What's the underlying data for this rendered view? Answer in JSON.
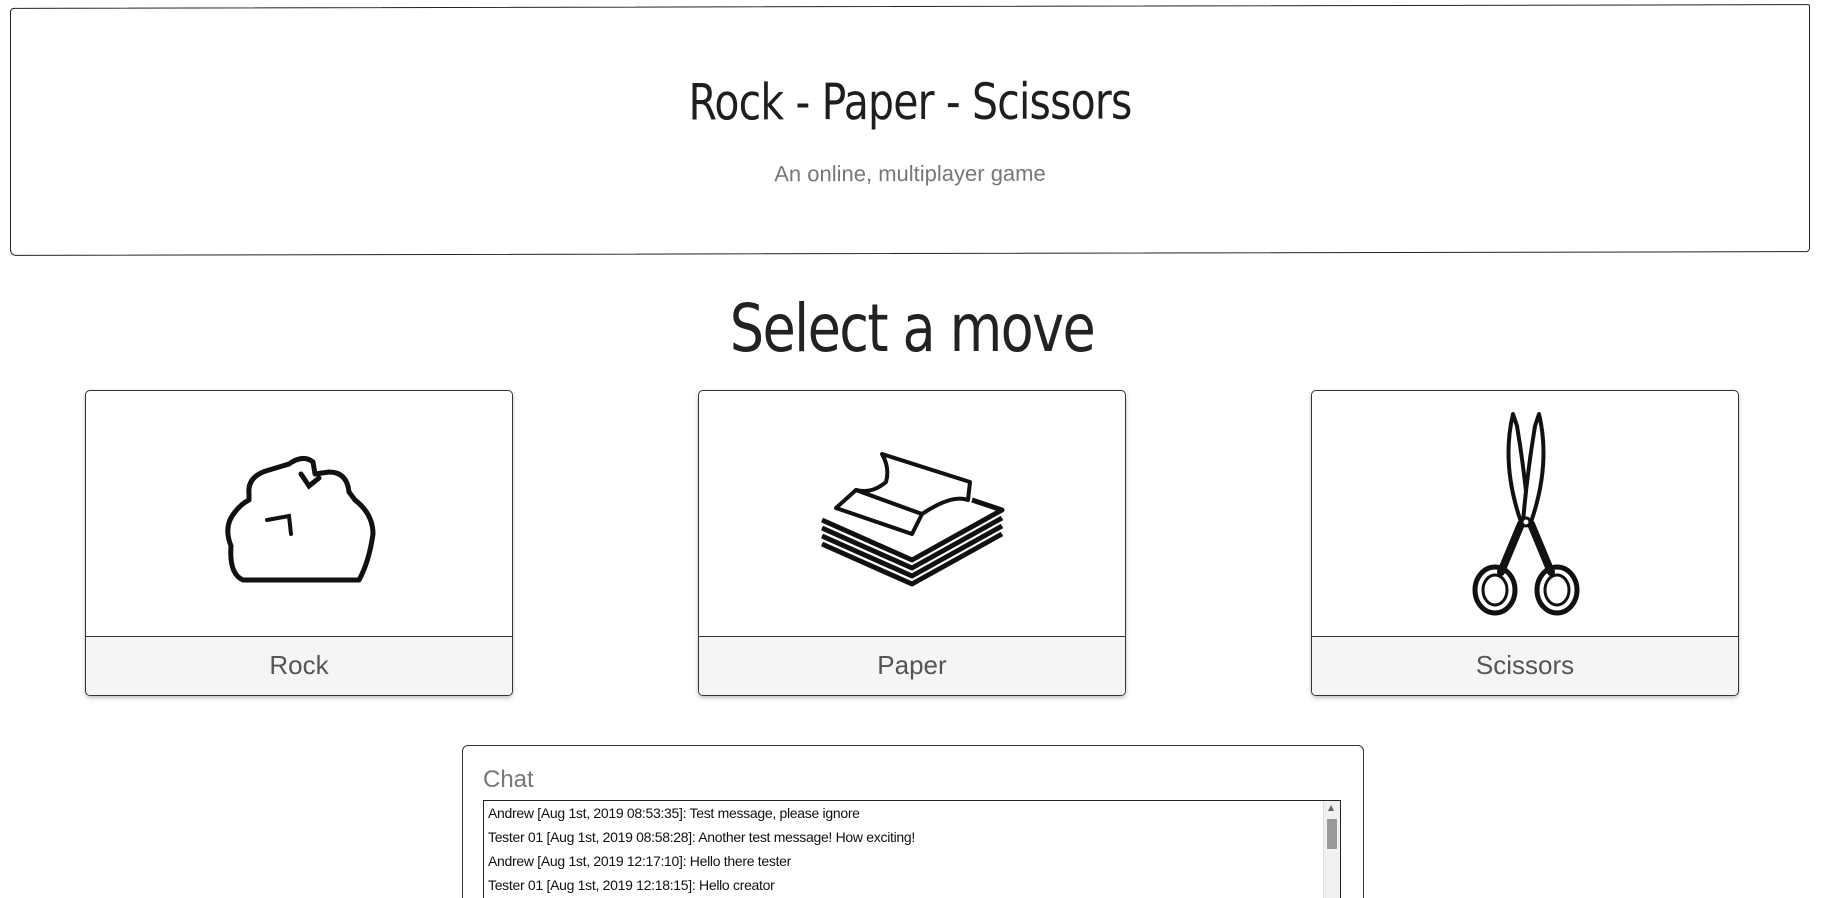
{
  "header": {
    "title": "Rock - Paper - Scissors",
    "subtitle": "An online, multiplayer game"
  },
  "moves": {
    "title": "Select a move",
    "options": [
      {
        "label": "Rock",
        "icon": "rock-icon"
      },
      {
        "label": "Paper",
        "icon": "paper-icon"
      },
      {
        "label": "Scissors",
        "icon": "scissors-icon"
      }
    ]
  },
  "chat": {
    "title": "Chat",
    "messages": [
      "Andrew [Aug 1st, 2019 08:53:35]: Test message, please ignore",
      "Tester 01 [Aug 1st, 2019 08:58:28]: Another test message! How exciting!",
      "Andrew [Aug 1st, 2019 12:17:10]: Hello there tester",
      "Tester 01 [Aug 1st, 2019 12:18:15]: Hello creator"
    ]
  },
  "colors": {
    "border": "#333333",
    "label_bg": "#f5f5f5",
    "muted_text": "#777777"
  }
}
